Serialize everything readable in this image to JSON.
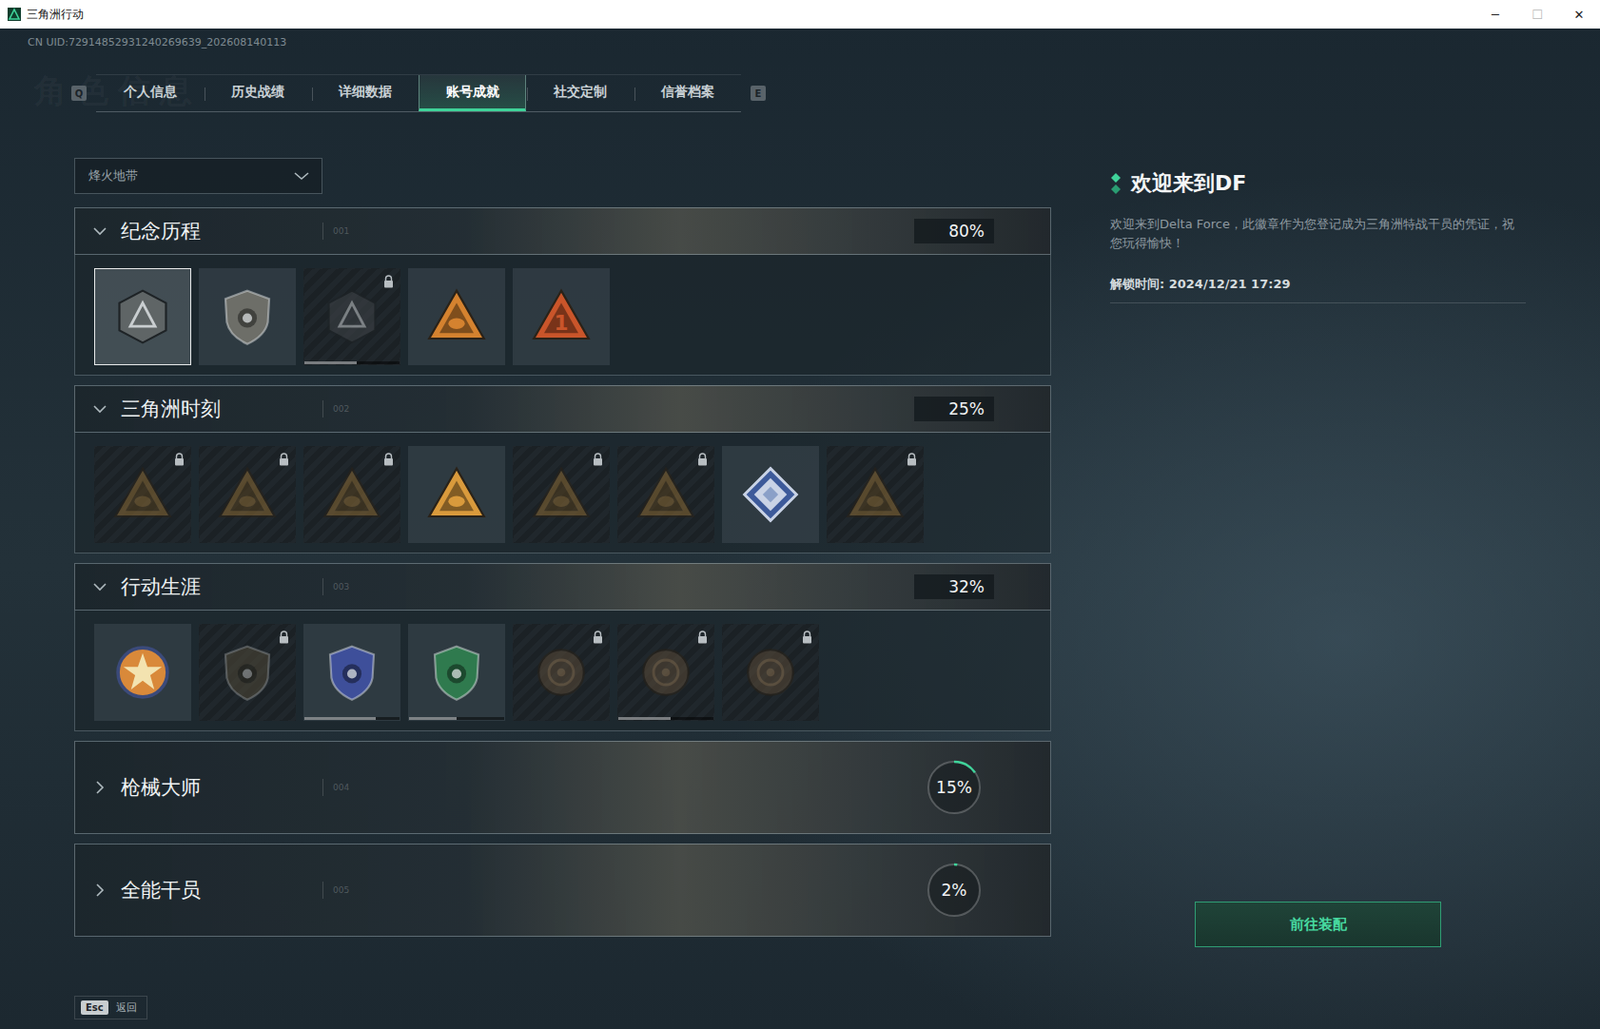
{
  "window": {
    "title": "三角洲行动",
    "controls": [
      {
        "glyph": "─",
        "disabled": false
      },
      {
        "glyph": "☐",
        "disabled": true
      },
      {
        "glyph": "✕",
        "disabled": false
      }
    ]
  },
  "uid": "CN UID:72914852931240269639_202608140113",
  "watermark": "角色信息",
  "tabs": {
    "prev_key": "Q",
    "next_key": "E",
    "items": [
      {
        "label": "个人信息",
        "selected": false
      },
      {
        "label": "历史战绩",
        "selected": false
      },
      {
        "label": "详细数据",
        "selected": false
      },
      {
        "label": "账号成就",
        "selected": true
      },
      {
        "label": "社交定制",
        "selected": false
      },
      {
        "label": "信誉档案",
        "selected": false
      }
    ]
  },
  "mode_select": {
    "value": "烽火地带"
  },
  "sections": [
    {
      "title": "纪念历程",
      "index": "001",
      "percent": "80%",
      "expanded": true,
      "badges": [
        {
          "kind": "hexagon",
          "color": "#5f6566",
          "locked": false,
          "selected": true
        },
        {
          "kind": "shield",
          "color": "#6d6e68",
          "locked": false,
          "selected": false
        },
        {
          "kind": "hexagon",
          "color": "#3f4448",
          "locked": true,
          "selected": false,
          "progress": 0.55
        },
        {
          "kind": "triangle",
          "color": "#d4822f",
          "locked": false,
          "selected": false
        },
        {
          "kind": "triangle",
          "color": "#c9552a",
          "locked": false,
          "selected": false,
          "mark": "1"
        }
      ]
    },
    {
      "title": "三角洲时刻",
      "index": "002",
      "percent": "25%",
      "expanded": true,
      "badges": [
        {
          "kind": "triangle",
          "color": "#8a6a35",
          "locked": true,
          "selected": false
        },
        {
          "kind": "triangle",
          "color": "#8a6a35",
          "locked": true,
          "selected": false
        },
        {
          "kind": "triangle",
          "color": "#8a6a35",
          "locked": true,
          "selected": false
        },
        {
          "kind": "triangle",
          "color": "#d99a3c",
          "locked": false,
          "selected": false
        },
        {
          "kind": "triangle",
          "color": "#8a6a35",
          "locked": true,
          "selected": false
        },
        {
          "kind": "triangle",
          "color": "#8a6a35",
          "locked": true,
          "selected": false
        },
        {
          "kind": "diamond",
          "color": "#c9d3e6",
          "locked": false,
          "selected": false
        },
        {
          "kind": "triangle",
          "color": "#8a6a35",
          "locked": true,
          "selected": false
        }
      ]
    },
    {
      "title": "行动生涯",
      "index": "003",
      "percent": "32%",
      "expanded": true,
      "badges": [
        {
          "kind": "star-medal",
          "color": "#d9893a",
          "locked": false,
          "selected": false
        },
        {
          "kind": "shield",
          "color": "#4e4838",
          "locked": true,
          "selected": false
        },
        {
          "kind": "shield",
          "color": "#3e4f9a",
          "locked": false,
          "selected": false,
          "progress": 0.75
        },
        {
          "kind": "shield",
          "color": "#2f7a4e",
          "locked": false,
          "selected": false,
          "progress": 0.5
        },
        {
          "kind": "round",
          "color": "#5a4a38",
          "locked": true,
          "selected": false
        },
        {
          "kind": "round",
          "color": "#5a4a38",
          "locked": true,
          "selected": false,
          "progress": 0.55
        },
        {
          "kind": "round",
          "color": "#5a4a38",
          "locked": true,
          "selected": false
        }
      ]
    },
    {
      "title": "枪械大师",
      "index": "004",
      "percent": "15%",
      "expanded": false,
      "level": 0.15
    },
    {
      "title": "全能干员",
      "index": "005",
      "percent": "2%",
      "expanded": false,
      "level": 0.02
    }
  ],
  "detail": {
    "title": "欢迎来到DF",
    "description": "欢迎来到Delta Force，此徽章作为您登记成为三角洲特战干员的凭证，祝您玩得愉快！",
    "unlock": "解锁时间: 2024/12/21 17:29"
  },
  "button": "前往装配",
  "footer": {
    "key": "Esc",
    "label": "返回"
  }
}
